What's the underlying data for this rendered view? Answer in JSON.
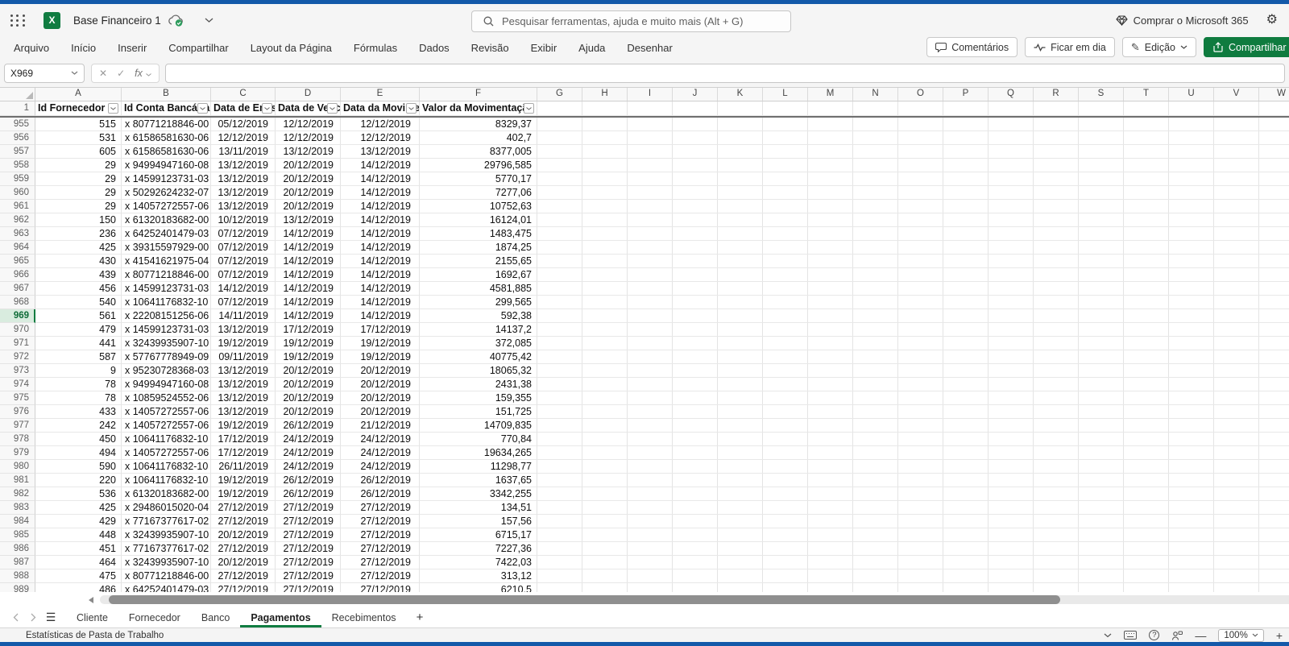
{
  "chrome": {
    "app_title": "Base Financeiro 1",
    "search_placeholder": "Pesquisar ferramentas, ajuda e muito mais (Alt + G)",
    "buy_microsoft": "Comprar o Microsoft 365",
    "excel_icon_letter": "X"
  },
  "menus": [
    "Arquivo",
    "Início",
    "Inserir",
    "Compartilhar",
    "Layout da Página",
    "Fórmulas",
    "Dados",
    "Revisão",
    "Exibir",
    "Ajuda",
    "Desenhar"
  ],
  "ribbon_buttons": {
    "comments": "Comentários",
    "catch_up": "Ficar em dia",
    "editing": "Edição",
    "share": "Compartilhar"
  },
  "formula_bar": {
    "name_box": "X969",
    "fx_label": "fx",
    "formula_value": ""
  },
  "grid": {
    "column_letters": [
      "A",
      "B",
      "C",
      "D",
      "E",
      "F",
      "G",
      "H",
      "I",
      "J",
      "K",
      "L",
      "M",
      "N",
      "O",
      "P",
      "Q",
      "R",
      "S",
      "T",
      "U",
      "V",
      "W"
    ],
    "header_row_number": "1",
    "headers": [
      "Id Fornecedor",
      "Id Conta Bancária",
      "Data de Emissão",
      "Data de Vencimento",
      "Data da Movimentação",
      "Valor da Movimentação"
    ],
    "selected_row": "969",
    "rows": [
      [
        "955",
        "515",
        "x 80771218846-00",
        "05/12/2019",
        "12/12/2019",
        "12/12/2019",
        "8329,37"
      ],
      [
        "956",
        "531",
        "x 61586581630-06",
        "12/12/2019",
        "12/12/2019",
        "12/12/2019",
        "402,7"
      ],
      [
        "957",
        "605",
        "x 61586581630-06",
        "13/11/2019",
        "13/12/2019",
        "13/12/2019",
        "8377,005"
      ],
      [
        "958",
        "29",
        "x 94994947160-08",
        "13/12/2019",
        "20/12/2019",
        "14/12/2019",
        "29796,585"
      ],
      [
        "959",
        "29",
        "x 14599123731-03",
        "13/12/2019",
        "20/12/2019",
        "14/12/2019",
        "5770,17"
      ],
      [
        "960",
        "29",
        "x 50292624232-07",
        "13/12/2019",
        "20/12/2019",
        "14/12/2019",
        "7277,06"
      ],
      [
        "961",
        "29",
        "x 14057272557-06",
        "13/12/2019",
        "20/12/2019",
        "14/12/2019",
        "10752,63"
      ],
      [
        "962",
        "150",
        "x 61320183682-00",
        "10/12/2019",
        "13/12/2019",
        "14/12/2019",
        "16124,01"
      ],
      [
        "963",
        "236",
        "x 64252401479-03",
        "07/12/2019",
        "14/12/2019",
        "14/12/2019",
        "1483,475"
      ],
      [
        "964",
        "425",
        "x 39315597929-00",
        "07/12/2019",
        "14/12/2019",
        "14/12/2019",
        "1874,25"
      ],
      [
        "965",
        "430",
        "x 41541621975-04",
        "07/12/2019",
        "14/12/2019",
        "14/12/2019",
        "2155,65"
      ],
      [
        "966",
        "439",
        "x 80771218846-00",
        "07/12/2019",
        "14/12/2019",
        "14/12/2019",
        "1692,67"
      ],
      [
        "967",
        "456",
        "x 14599123731-03",
        "14/12/2019",
        "14/12/2019",
        "14/12/2019",
        "4581,885"
      ],
      [
        "968",
        "540",
        "x 10641176832-10",
        "07/12/2019",
        "14/12/2019",
        "14/12/2019",
        "299,565"
      ],
      [
        "969",
        "561",
        "x 22208151256-06",
        "14/11/2019",
        "14/12/2019",
        "14/12/2019",
        "592,38"
      ],
      [
        "970",
        "479",
        "x 14599123731-03",
        "13/12/2019",
        "17/12/2019",
        "17/12/2019",
        "14137,2"
      ],
      [
        "971",
        "441",
        "x 32439935907-10",
        "19/12/2019",
        "19/12/2019",
        "19/12/2019",
        "372,085"
      ],
      [
        "972",
        "587",
        "x 57767778949-09",
        "09/11/2019",
        "19/12/2019",
        "19/12/2019",
        "40775,42"
      ],
      [
        "973",
        "9",
        "x 95230728368-03",
        "13/12/2019",
        "20/12/2019",
        "20/12/2019",
        "18065,32"
      ],
      [
        "974",
        "78",
        "x 94994947160-08",
        "13/12/2019",
        "20/12/2019",
        "20/12/2019",
        "2431,38"
      ],
      [
        "975",
        "78",
        "x 10859524552-06",
        "13/12/2019",
        "20/12/2019",
        "20/12/2019",
        "159,355"
      ],
      [
        "976",
        "433",
        "x 14057272557-06",
        "13/12/2019",
        "20/12/2019",
        "20/12/2019",
        "151,725"
      ],
      [
        "977",
        "242",
        "x 14057272557-06",
        "19/12/2019",
        "26/12/2019",
        "21/12/2019",
        "14709,835"
      ],
      [
        "978",
        "450",
        "x 10641176832-10",
        "17/12/2019",
        "24/12/2019",
        "24/12/2019",
        "770,84"
      ],
      [
        "979",
        "494",
        "x 14057272557-06",
        "17/12/2019",
        "24/12/2019",
        "24/12/2019",
        "19634,265"
      ],
      [
        "980",
        "590",
        "x 10641176832-10",
        "26/11/2019",
        "24/12/2019",
        "24/12/2019",
        "11298,77"
      ],
      [
        "981",
        "220",
        "x 10641176832-10",
        "19/12/2019",
        "26/12/2019",
        "26/12/2019",
        "1637,65"
      ],
      [
        "982",
        "536",
        "x 61320183682-00",
        "19/12/2019",
        "26/12/2019",
        "26/12/2019",
        "3342,255"
      ],
      [
        "983",
        "425",
        "x 29486015020-04",
        "27/12/2019",
        "27/12/2019",
        "27/12/2019",
        "134,51"
      ],
      [
        "984",
        "429",
        "x 77167377617-02",
        "27/12/2019",
        "27/12/2019",
        "27/12/2019",
        "157,56"
      ],
      [
        "985",
        "448",
        "x 32439935907-10",
        "20/12/2019",
        "27/12/2019",
        "27/12/2019",
        "6715,17"
      ],
      [
        "986",
        "451",
        "x 77167377617-02",
        "27/12/2019",
        "27/12/2019",
        "27/12/2019",
        "7227,36"
      ],
      [
        "987",
        "464",
        "x 32439935907-10",
        "20/12/2019",
        "27/12/2019",
        "27/12/2019",
        "7422,03"
      ],
      [
        "988",
        "475",
        "x 80771218846-00",
        "27/12/2019",
        "27/12/2019",
        "27/12/2019",
        "313,12"
      ],
      [
        "989",
        "486",
        "x 64252401479-03",
        "27/12/2019",
        "27/12/2019",
        "27/12/2019",
        "6210,5"
      ]
    ]
  },
  "sheet_bar": {
    "tabs": [
      "Cliente",
      "Fornecedor",
      "Banco",
      "Pagamentos",
      "Recebimentos"
    ],
    "active_tab": "Pagamentos"
  },
  "status_bar": {
    "workbook_stats": "Estatísticas de Pasta de Trabalho",
    "zoom_level": "100%"
  },
  "colors": {
    "accent_green": "#107c41",
    "frame_blue": "#1359a9",
    "share_button_green": "#0f7b3f"
  }
}
